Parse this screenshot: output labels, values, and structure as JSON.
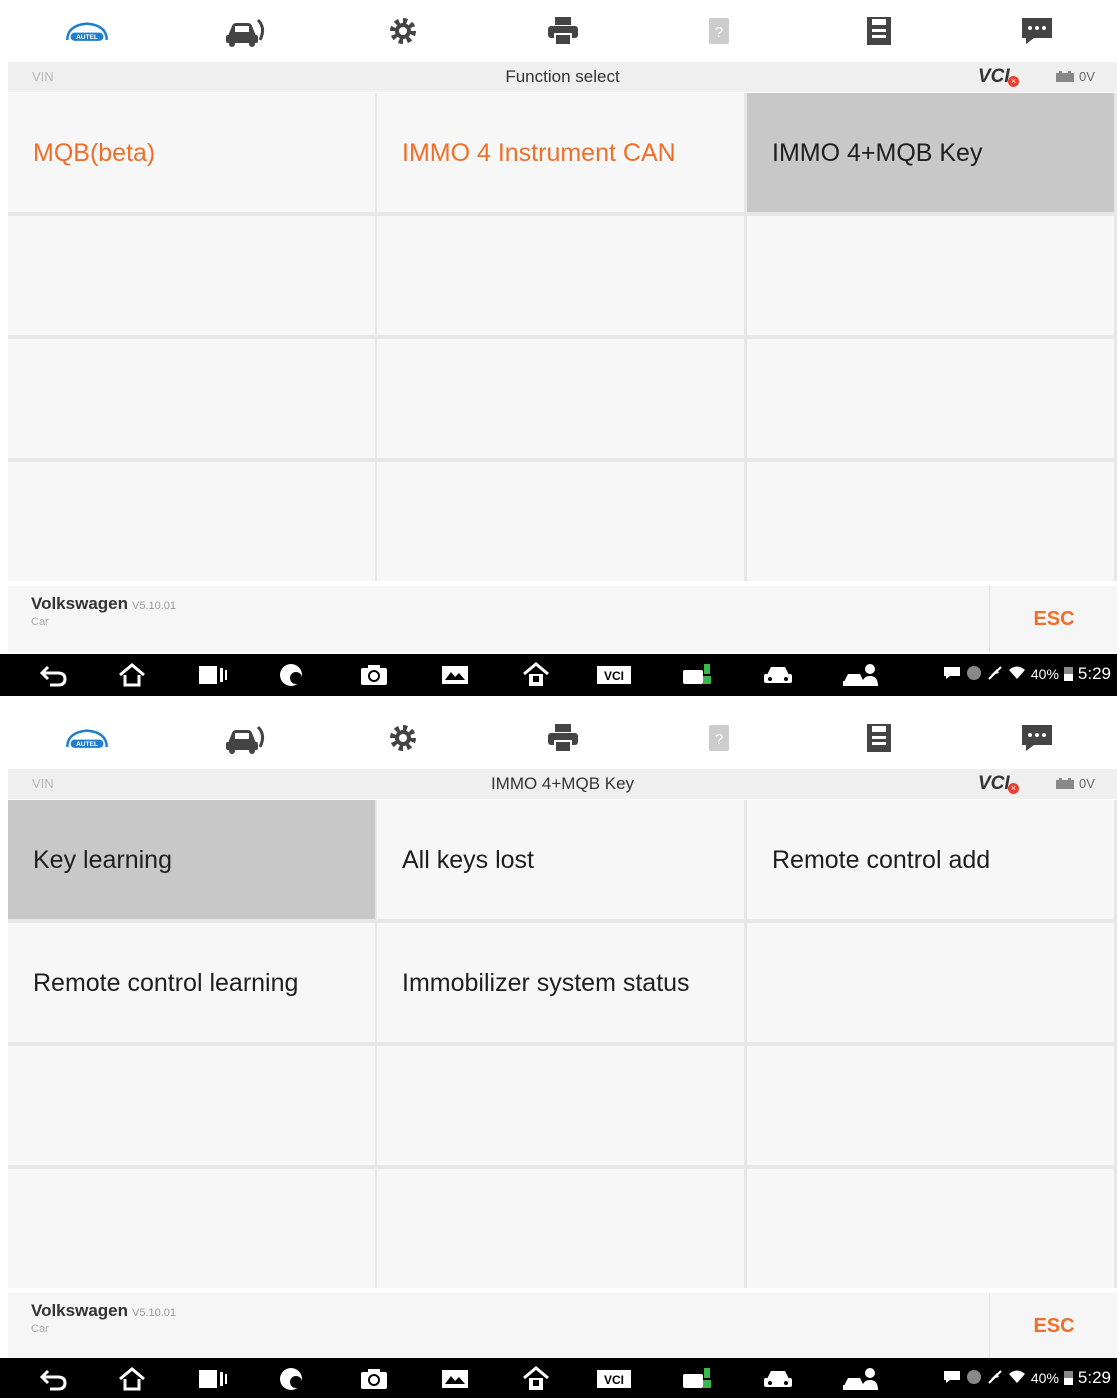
{
  "screens": [
    {
      "header": {
        "vin_label": "VIN",
        "title": "Function select",
        "vci_label": "VCI",
        "vci_badge": "×",
        "voltage": "0V"
      },
      "cells": [
        {
          "label": "MQB(beta)",
          "color": "#ef6f2a",
          "selected": false
        },
        {
          "label": "IMMO 4 Instrument CAN",
          "color": "#ef6f2a",
          "selected": false
        },
        {
          "label": "IMMO 4+MQB Key",
          "color": "#1e1e1e",
          "selected": true
        },
        {
          "label": ""
        },
        {
          "label": ""
        },
        {
          "label": ""
        },
        {
          "label": ""
        },
        {
          "label": ""
        },
        {
          "label": ""
        },
        {
          "label": ""
        },
        {
          "label": ""
        },
        {
          "label": ""
        }
      ],
      "footer": {
        "brand": "Volkswagen",
        "version": "V5.10.01",
        "subtitle": "Car",
        "esc_label": "ESC"
      },
      "status": {
        "battery": "40%",
        "time": "5:29"
      }
    },
    {
      "header": {
        "vin_label": "VIN",
        "title": "IMMO 4+MQB Key",
        "vci_label": "VCI",
        "vci_badge": "×",
        "voltage": "0V"
      },
      "cells": [
        {
          "label": "Key learning",
          "color": "#1e1e1e",
          "selected": true
        },
        {
          "label": "All keys lost",
          "color": "#1e1e1e",
          "selected": false
        },
        {
          "label": "Remote control add",
          "color": "#1e1e1e",
          "selected": false
        },
        {
          "label": "Remote control learning",
          "color": "#1e1e1e",
          "selected": false
        },
        {
          "label": "Immobilizer system status",
          "color": "#1e1e1e",
          "selected": false
        },
        {
          "label": ""
        },
        {
          "label": ""
        },
        {
          "label": ""
        },
        {
          "label": ""
        },
        {
          "label": ""
        },
        {
          "label": ""
        },
        {
          "label": ""
        }
      ],
      "footer": {
        "brand": "Volkswagen",
        "version": "V5.10.01",
        "subtitle": "Car",
        "esc_label": "ESC"
      },
      "status": {
        "battery": "40%",
        "time": "5:29"
      }
    }
  ],
  "toolbar_icons": [
    "autel-home-icon",
    "vehicle-switch-icon",
    "settings-gear-icon",
    "print-icon",
    "help-icon",
    "save-data-icon",
    "data-logging-icon"
  ],
  "toolbar_logo_text": "AUTEL",
  "navbar_icons": [
    "back-icon",
    "home-icon",
    "recent-apps-icon",
    "browser-icon",
    "camera-icon",
    "screenshot-icon",
    "maxisys-home-icon",
    "vci-icon",
    "vehicle-connect-icon",
    "car-icon",
    "remote-expert-icon"
  ],
  "navbar_vci_text": "VCI",
  "colors": {
    "accent": "#ef6f2a",
    "selected": "#c8c8c8",
    "cell": "#f7f7f7",
    "grid_line": "#e7e7e7"
  }
}
